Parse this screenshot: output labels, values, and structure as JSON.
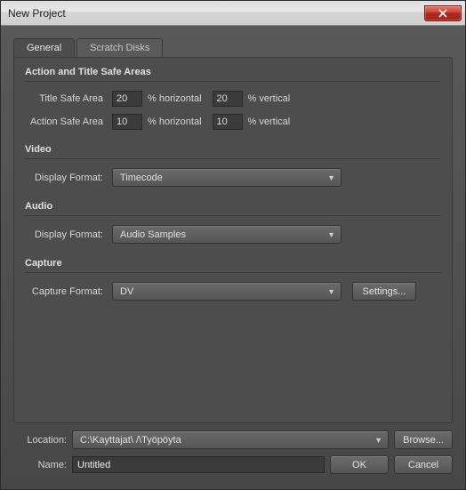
{
  "window": {
    "title": "New Project"
  },
  "tabs": {
    "general": "General",
    "scratch": "Scratch Disks"
  },
  "safe": {
    "heading": "Action and Title Safe Areas",
    "title_label": "Title Safe Area",
    "action_label": "Action Safe Area",
    "title_h": "20",
    "title_v": "20",
    "action_h": "10",
    "action_v": "10",
    "pct_h": "% horizontal",
    "pct_v": "% vertical"
  },
  "video": {
    "heading": "Video",
    "display_format_label": "Display Format:",
    "display_format_value": "Timecode"
  },
  "audio": {
    "heading": "Audio",
    "display_format_label": "Display Format:",
    "display_format_value": "Audio Samples"
  },
  "capture": {
    "heading": "Capture",
    "format_label": "Capture Format:",
    "format_value": "DV",
    "settings_label": "Settings..."
  },
  "location": {
    "label": "Location:",
    "value": "C:\\Kayttajat\\            /\\Työpöyta",
    "browse": "Browse..."
  },
  "name": {
    "label": "Name:",
    "value": "Untitled"
  },
  "buttons": {
    "ok": "OK",
    "cancel": "Cancel"
  }
}
